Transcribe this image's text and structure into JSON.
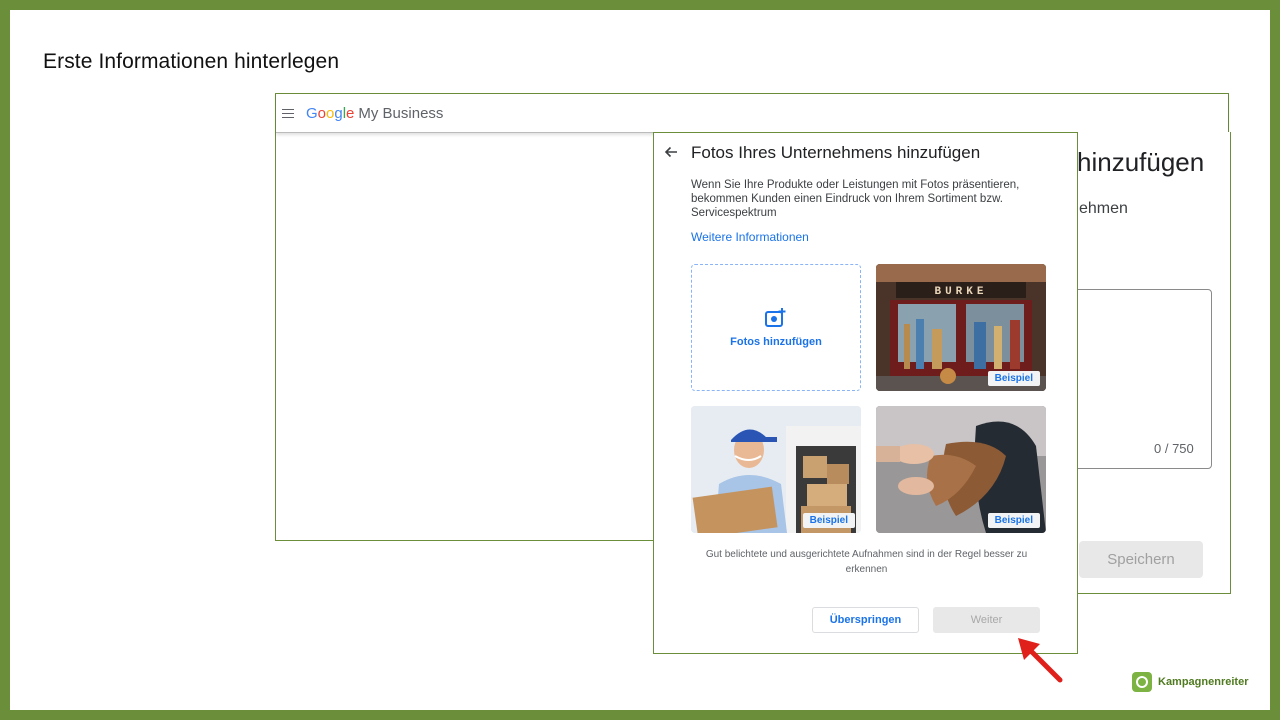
{
  "slide": {
    "title": "Erste Informationen hinterlegen"
  },
  "gmb": {
    "logo": {
      "g": "G",
      "o1": "o",
      "o2": "o",
      "g2": "g",
      "l": "l",
      "e": "e",
      "product": "My Business"
    },
    "background": {
      "heading_fragment": "hinzufügen",
      "sub_fragment": "ehmen",
      "counter": "0 / 750",
      "save_label": "Speichern"
    }
  },
  "dialog": {
    "title": "Fotos Ihres Unternehmens hinzufügen",
    "description": "Wenn Sie Ihre Produkte oder Leistungen mit Fotos präsentieren, bekommen Kunden einen Eindruck von Ihrem Sortiment bzw. Servicespektrum",
    "link": "Weitere Informationen",
    "add_photos": "Fotos hinzufügen",
    "example_badge": "Beispiel",
    "shop_sign": "BURKE",
    "hint": "Gut belichtete und ausgerichtete Aufnahmen sind in der Regel besser zu erkennen",
    "skip_label": "Überspringen",
    "next_label": "Weiter"
  },
  "brand": {
    "name": "Kampagnenreiter"
  },
  "colors": {
    "frame": "#6b8e3a",
    "link": "#1a73e8",
    "arrow": "#e0201b"
  }
}
